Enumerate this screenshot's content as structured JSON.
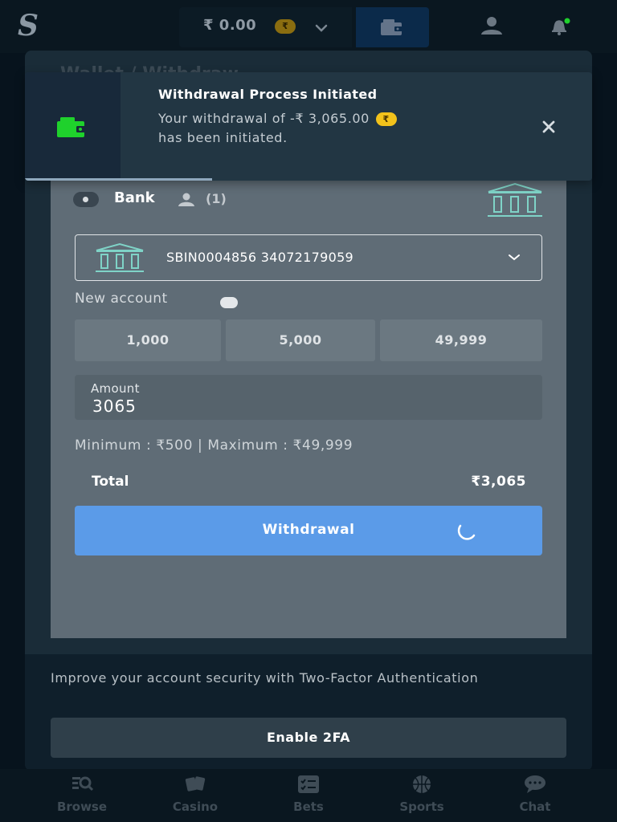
{
  "topbar": {
    "logo": "S",
    "balance": "₹ 0.00",
    "currency_symbol": "₹"
  },
  "modal": {
    "title": "Wallet / Withdraw"
  },
  "payment_method": {
    "label": "Bank",
    "count": "(1)"
  },
  "account_select": {
    "value": "SBIN0004856 34072179059"
  },
  "new_account": {
    "label": "New account"
  },
  "presets": [
    "1,000",
    "5,000",
    "49,999"
  ],
  "amount": {
    "label": "Amount",
    "value": "3065"
  },
  "limits": "Minimum : ₹500 | Maximum : ₹49,999",
  "total": {
    "label": "Total",
    "value": "₹3,065"
  },
  "withdraw_button": {
    "label": "Withdrawal"
  },
  "security": {
    "text": "Improve your account security with Two-Factor Authentication",
    "button": "Enable 2FA"
  },
  "toast": {
    "title": "Withdrawal Process Initiated",
    "body_prefix": "Your withdrawal of -₹ 3,065.00",
    "coin_symbol": "₹",
    "body_suffix": "has been initiated.",
    "progress_fraction": 0.33
  },
  "bottom_nav": [
    {
      "label": "Browse",
      "icon": "browse-icon"
    },
    {
      "label": "Casino",
      "icon": "casino-icon"
    },
    {
      "label": "Bets",
      "icon": "bets-icon"
    },
    {
      "label": "Sports",
      "icon": "sports-icon"
    },
    {
      "label": "Chat",
      "icon": "chat-icon"
    }
  ],
  "colors": {
    "accent_button": "#5b9be8",
    "wallet_green": "#1fd12c",
    "bank_icon": "#7fd3c7",
    "coin_gold": "#f2c21b"
  }
}
